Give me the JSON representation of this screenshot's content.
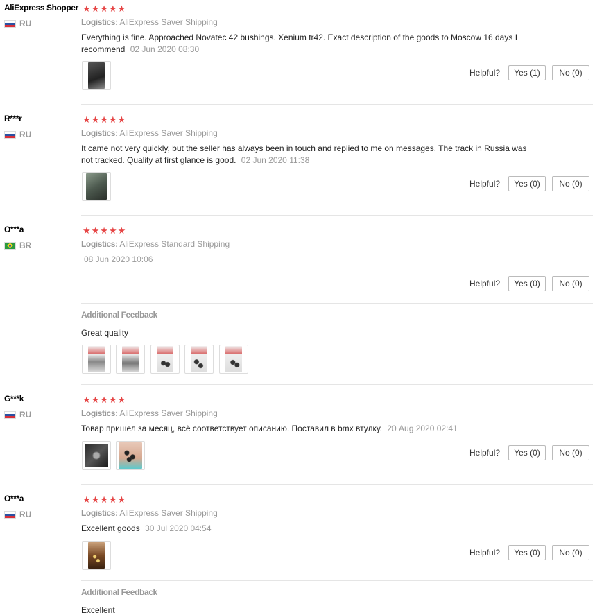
{
  "ui": {
    "logistics_label": "Logistics:",
    "helpful_label": "Helpful?",
    "additional_feedback_label": "Additional Feedback",
    "stars": "★★★★★"
  },
  "colors": {
    "star": "#e64545",
    "muted": "#999999",
    "border": "#dddddd"
  },
  "reviews": [
    {
      "user": "AliExpress Shopper",
      "country": "RU",
      "flag": "flag-ru",
      "logistics": "AliExpress Saver Shipping",
      "text": "Everything is fine. Approached Novatec 42 bushings. Xenium tr42. Exact description of the goods to Moscow 16 days I recommend",
      "date": "02 Jun 2020 08:30",
      "photos": [
        "photo-dark-bag"
      ],
      "yes": "Yes (1)",
      "no": "No (0)"
    },
    {
      "user": "R***r",
      "country": "RU",
      "flag": "flag-ru",
      "logistics": "AliExpress Saver Shipping",
      "text": "It came not very quickly, but the seller has always been in touch and replied to me on messages. The track in Russia was not tracked. Quality at first glance is good.",
      "date": "02 Jun 2020 11:38",
      "photos": [
        "photo-package"
      ],
      "yes": "Yes (0)",
      "no": "No (0)"
    },
    {
      "user": "O***a",
      "country": "BR",
      "flag": "flag-br",
      "logistics": "AliExpress Standard Shipping",
      "text": "",
      "date": "08 Jun 2020 10:06",
      "photos": [],
      "yes": "Yes (0)",
      "no": "No (0)",
      "additional": {
        "text": "Great quality",
        "photos": [
          "photo-bag-1",
          "photo-bag-2",
          "photo-bag-3",
          "photo-bag-4",
          "photo-bag-5"
        ]
      }
    },
    {
      "user": "G***k",
      "country": "RU",
      "flag": "flag-ru",
      "logistics": "AliExpress Saver Shipping",
      "text": "Товар пришел за месяц, всё соответствует описанию. Поставил в bmx втулку.",
      "date": "20 Aug 2020 02:41",
      "photos": [
        "photo-dark-pack",
        "photo-hand-balls"
      ],
      "yes": "Yes (0)",
      "no": "No (0)"
    },
    {
      "user": "O***a",
      "country": "RU",
      "flag": "flag-ru",
      "logistics": "AliExpress Saver Shipping",
      "text": "Excellent goods",
      "date": "30 Jul 2020 04:54",
      "photos": [
        "photo-brown-balls"
      ],
      "yes": "Yes (0)",
      "no": "No (0)",
      "additional": {
        "text": "Excellent",
        "photos": []
      }
    }
  ]
}
